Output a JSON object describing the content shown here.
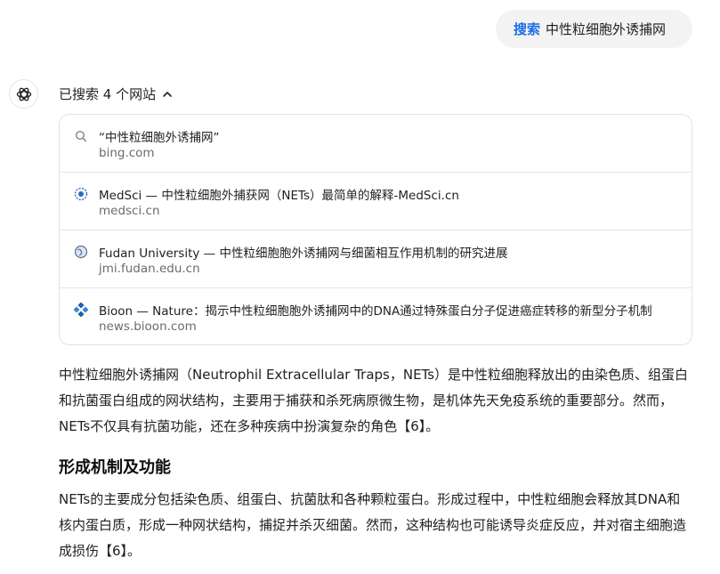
{
  "user_query": {
    "keyword": "搜索",
    "text": "中性粒细胞外诱捕网"
  },
  "searched": {
    "label": "已搜索 4 个网站"
  },
  "sources": [
    {
      "icon": "search-icon",
      "title": "“中性粒细胞外诱捕网”",
      "domain": "bing.com"
    },
    {
      "icon": "medsci-favicon",
      "title": "MedSci — 中性粒细胞外捕获网（NETs）最简单的解释-MedSci.cn",
      "domain": "medsci.cn"
    },
    {
      "icon": "globe-icon",
      "title": "Fudan University — 中性粒细胞胞外诱捕网与细菌相互作用机制的研究进展",
      "domain": "jmi.fudan.edu.cn"
    },
    {
      "icon": "bioon-favicon",
      "title": "Bioon — Nature：揭示中性粒细胞胞外诱捕网中的DNA通过特殊蛋白分子促进癌症转移的新型分子机制",
      "domain": "news.bioon.com"
    }
  ],
  "answer": {
    "intro": "中性粒细胞外诱捕网（Neutrophil Extracellular Traps，NETs）是中性粒细胞释放出的由染色质、组蛋白和抗菌蛋白组成的网状结构，主要用于捕获和杀死病原微生物，是机体先天免疫系统的重要部分。然而，NETs不仅具有抗菌功能，还在多种疾病中扮演复杂的角色【6】。",
    "section_title": "形成机制及功能",
    "section_body": "NETs的主要成分包括染色质、组蛋白、抗菌肽和各种颗粒蛋白。形成过程中，中性粒细胞会释放其DNA和核内蛋白质，形成一种网状结构，捕捉并杀灭细菌。然而，这种结构也可能诱导炎症反应，并对宿主细胞造成损伤【6】。"
  }
}
